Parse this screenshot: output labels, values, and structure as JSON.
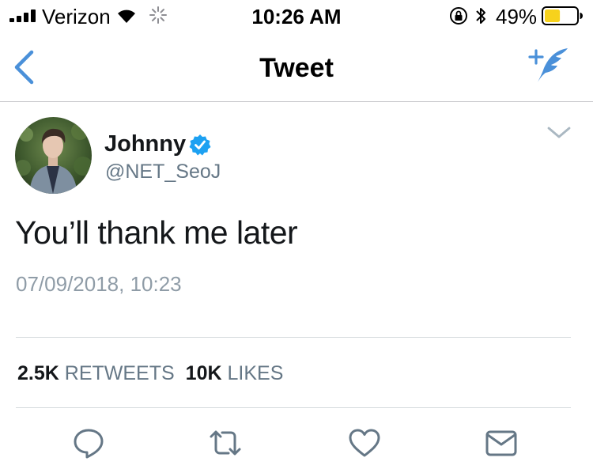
{
  "status_bar": {
    "carrier": "Verizon",
    "time": "10:26 AM",
    "battery_percent": "49%",
    "battery_level": 0.49,
    "icons": [
      "signal-icon",
      "wifi-icon",
      "activity-spinner-icon",
      "orientation-lock-icon",
      "bluetooth-icon",
      "battery-icon"
    ]
  },
  "nav": {
    "title": "Tweet",
    "back_icon": "chevron-left-icon",
    "compose_icon": "compose-tweet-icon"
  },
  "tweet": {
    "display_name": "Johnny",
    "verified": true,
    "handle": "@NET_SeoJ",
    "text": "You’ll thank me later",
    "timestamp": "07/09/2018, 10:23",
    "caret_icon": "chevron-down-icon"
  },
  "stats": {
    "retweets_count": "2.5K",
    "retweets_label": "RETWEETS",
    "likes_count": "10K",
    "likes_label": "LIKES"
  },
  "actions": [
    "reply-icon",
    "retweet-icon",
    "like-icon",
    "direct-message-icon"
  ],
  "colors": {
    "accent": "#1da1f2",
    "nav_blue": "#4a90d9",
    "text": "#14171a",
    "secondary": "#657786",
    "battery": "#f7d21c"
  }
}
